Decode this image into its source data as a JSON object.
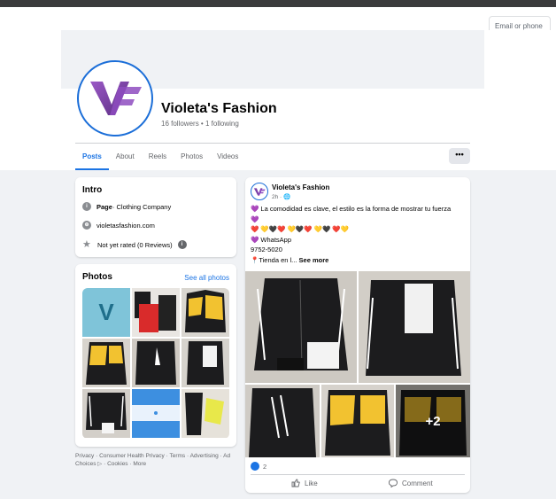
{
  "header": {
    "login_placeholder": "Email or phone"
  },
  "profile": {
    "name": "Violeta's Fashion",
    "followers": "16 followers",
    "following": "1 following",
    "separator": "•",
    "logo_letters": "VF",
    "tabs": [
      {
        "label": "Posts",
        "active": true
      },
      {
        "label": "About"
      },
      {
        "label": "Reels"
      },
      {
        "label": "Photos"
      },
      {
        "label": "Videos"
      }
    ],
    "more_label": "•••"
  },
  "intro": {
    "title": "Intro",
    "category_prefix": "Page",
    "category": " · Clothing Company",
    "website": "violetasfashion.com",
    "rating": "Not yet rated (0 Reviews)",
    "icons": [
      "info-icon",
      "globe-icon",
      "star-icon",
      "info-icon"
    ]
  },
  "photos": {
    "title": "Photos",
    "see_all": "See all photos",
    "logo_letter": "V"
  },
  "footer": {
    "links": [
      "Privacy",
      "Consumer Health Privacy",
      "Terms",
      "Advertising",
      "Ad Choices",
      "Cookies",
      "More"
    ],
    "separator": " · "
  },
  "post": {
    "author": "Violeta's Fashion",
    "time": "2h · ",
    "lines": [
      "💜 La comodidad es clave, el estilo es la forma de mostrar tu fuerza",
      "💜",
      "❤️ 💛🖤❤️ 💛🖤❤️ 💛🖤 ❤️💛",
      "💜 WhatsApp",
      "9752-5020"
    ],
    "last_line": "📍Tienda en l...",
    "see_more": "See more",
    "extra_photos": "+2",
    "reaction_count": "2",
    "like_label": "Like",
    "comment_label": "Comment"
  },
  "colors": {
    "brand_blue": "#1b74e4",
    "logo_purple": "#7b3fa8",
    "jacket_black": "#1c1c1e",
    "jacket_yellow": "#f2c230"
  }
}
